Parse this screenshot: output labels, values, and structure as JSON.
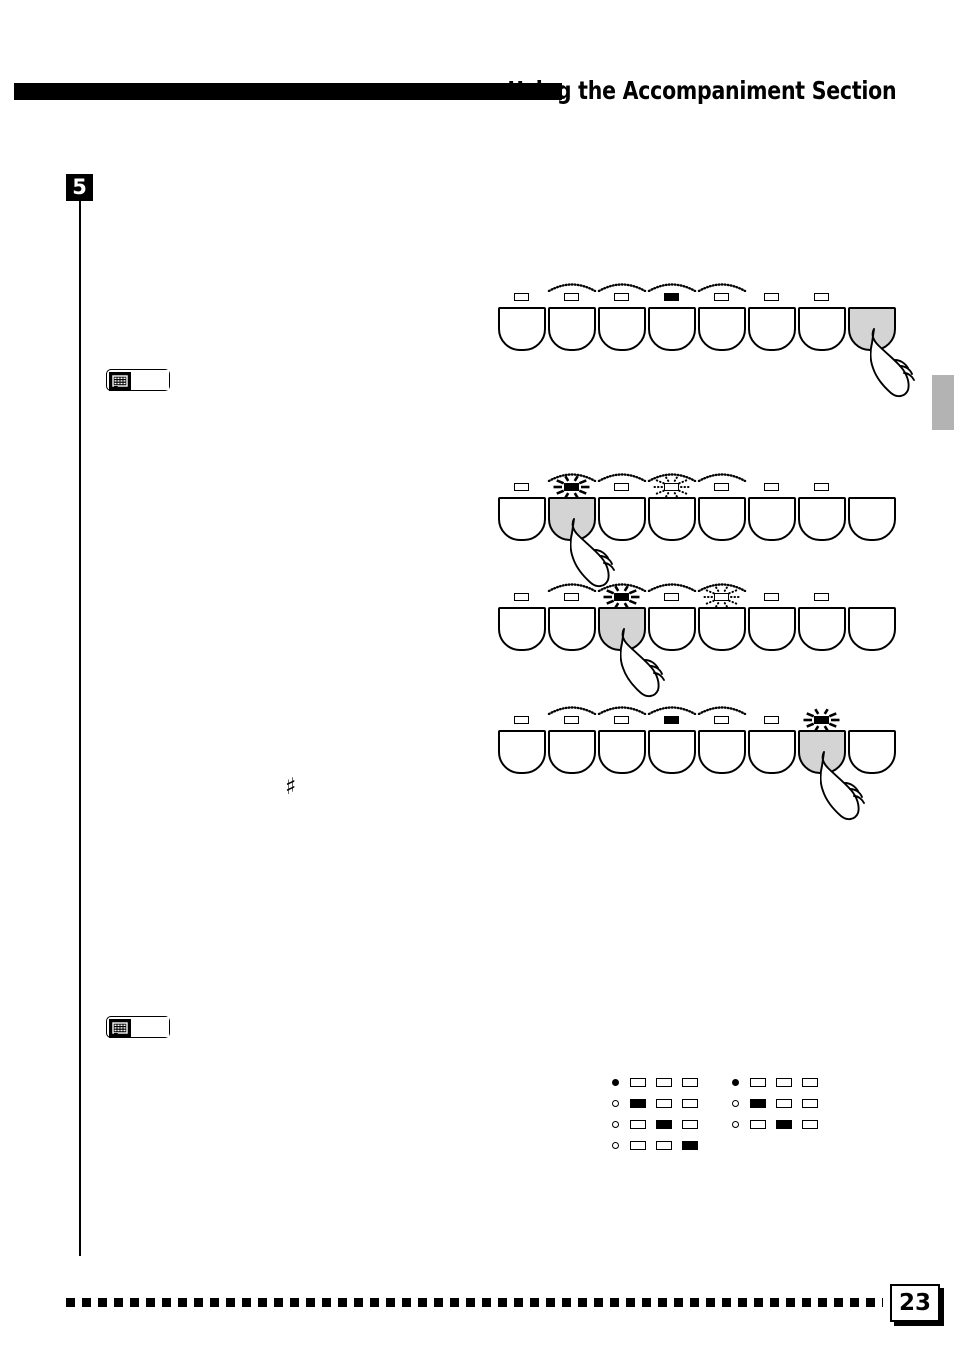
{
  "page": {
    "number": "23",
    "header_title": "Using the Accompaniment Section",
    "step_number": "5",
    "sharp_symbol": "♯"
  },
  "note_badges": [
    {
      "icon": "lcd-screen-icon",
      "label": ""
    },
    {
      "icon": "lcd-screen-icon",
      "label": ""
    }
  ],
  "button_rows": [
    {
      "id": "row-1",
      "buttons": [
        {
          "index": 1,
          "pressed": false,
          "led": "off",
          "arc": false,
          "flash": "none"
        },
        {
          "index": 2,
          "pressed": false,
          "led": "off",
          "arc": true,
          "flash": "none"
        },
        {
          "index": 3,
          "pressed": false,
          "led": "off",
          "arc": true,
          "flash": "none"
        },
        {
          "index": 4,
          "pressed": false,
          "led": "on",
          "arc": true,
          "flash": "none"
        },
        {
          "index": 5,
          "pressed": false,
          "led": "off",
          "arc": true,
          "flash": "none"
        },
        {
          "index": 6,
          "pressed": false,
          "led": "off",
          "arc": false,
          "flash": "none"
        },
        {
          "index": 7,
          "pressed": false,
          "led": "off",
          "arc": false,
          "flash": "none"
        },
        {
          "index": 8,
          "pressed": true,
          "led": "none",
          "arc": false,
          "flash": "none"
        }
      ],
      "hand_on_button": 8
    },
    {
      "id": "row-2",
      "buttons": [
        {
          "index": 1,
          "pressed": false,
          "led": "off",
          "arc": false,
          "flash": "none"
        },
        {
          "index": 2,
          "pressed": true,
          "led": "on",
          "arc": true,
          "flash": "solid"
        },
        {
          "index": 3,
          "pressed": false,
          "led": "off",
          "arc": true,
          "flash": "none"
        },
        {
          "index": 4,
          "pressed": false,
          "led": "off",
          "arc": true,
          "flash": "dotted"
        },
        {
          "index": 5,
          "pressed": false,
          "led": "off",
          "arc": true,
          "flash": "none"
        },
        {
          "index": 6,
          "pressed": false,
          "led": "off",
          "arc": false,
          "flash": "none"
        },
        {
          "index": 7,
          "pressed": false,
          "led": "off",
          "arc": false,
          "flash": "none"
        },
        {
          "index": 8,
          "pressed": false,
          "led": "none",
          "arc": false,
          "flash": "none"
        }
      ],
      "hand_on_button": 2
    },
    {
      "id": "row-3",
      "buttons": [
        {
          "index": 1,
          "pressed": false,
          "led": "off",
          "arc": false,
          "flash": "none"
        },
        {
          "index": 2,
          "pressed": false,
          "led": "off",
          "arc": true,
          "flash": "none"
        },
        {
          "index": 3,
          "pressed": true,
          "led": "on",
          "arc": true,
          "flash": "solid"
        },
        {
          "index": 4,
          "pressed": false,
          "led": "off",
          "arc": true,
          "flash": "none"
        },
        {
          "index": 5,
          "pressed": false,
          "led": "off",
          "arc": true,
          "flash": "dotted"
        },
        {
          "index": 6,
          "pressed": false,
          "led": "off",
          "arc": false,
          "flash": "none"
        },
        {
          "index": 7,
          "pressed": false,
          "led": "off",
          "arc": false,
          "flash": "none"
        },
        {
          "index": 8,
          "pressed": false,
          "led": "none",
          "arc": false,
          "flash": "none"
        }
      ],
      "hand_on_button": 3
    },
    {
      "id": "row-4",
      "buttons": [
        {
          "index": 1,
          "pressed": false,
          "led": "off",
          "arc": false,
          "flash": "none"
        },
        {
          "index": 2,
          "pressed": false,
          "led": "off",
          "arc": true,
          "flash": "none"
        },
        {
          "index": 3,
          "pressed": false,
          "led": "off",
          "arc": true,
          "flash": "none"
        },
        {
          "index": 4,
          "pressed": false,
          "led": "on",
          "arc": true,
          "flash": "none"
        },
        {
          "index": 5,
          "pressed": false,
          "led": "off",
          "arc": true,
          "flash": "none"
        },
        {
          "index": 6,
          "pressed": false,
          "led": "off",
          "arc": false,
          "flash": "none"
        },
        {
          "index": 7,
          "pressed": true,
          "led": "on",
          "arc": false,
          "flash": "solid"
        },
        {
          "index": 8,
          "pressed": false,
          "led": "none",
          "arc": false,
          "flash": "none"
        }
      ],
      "hand_on_button": 7
    }
  ],
  "led_pattern": {
    "left_group": [
      {
        "dot": "filled",
        "leds": [
          "off",
          "off",
          "off"
        ]
      },
      {
        "dot": "hollow",
        "leds": [
          "on",
          "off",
          "off"
        ]
      },
      {
        "dot": "hollow",
        "leds": [
          "off",
          "on",
          "off"
        ]
      },
      {
        "dot": "hollow",
        "leds": [
          "off",
          "off",
          "on"
        ]
      }
    ],
    "right_group": [
      {
        "dot": "filled",
        "leds": [
          "off",
          "off",
          "off"
        ]
      },
      {
        "dot": "hollow",
        "leds": [
          "on",
          "off",
          "off"
        ]
      },
      {
        "dot": "hollow",
        "leds": [
          "off",
          "on",
          "off"
        ]
      }
    ]
  },
  "colors": {
    "ink": "#000000",
    "paper": "#ffffff",
    "pressed_key": "#d4d4d4",
    "side_tab": "#b3b3b3"
  }
}
